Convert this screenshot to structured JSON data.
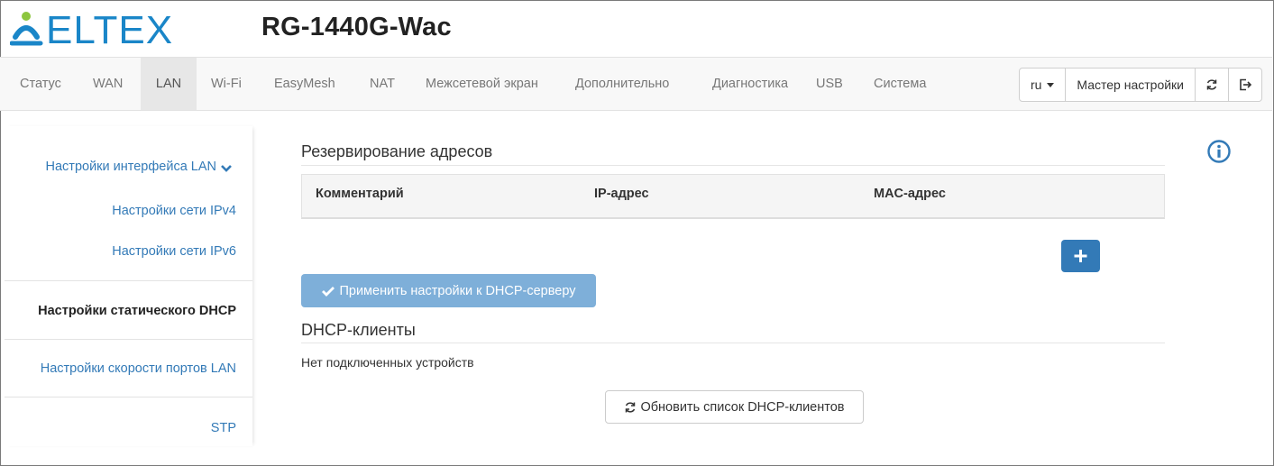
{
  "header": {
    "logo_text": "ELTEX",
    "device_name": "RG-1440G-Wac"
  },
  "nav": {
    "items": [
      {
        "label": "Статус",
        "active": false
      },
      {
        "label": "WAN",
        "active": false
      },
      {
        "label": "LAN",
        "active": true
      },
      {
        "label": "Wi-Fi",
        "active": false
      },
      {
        "label": "EasyMesh",
        "active": false
      },
      {
        "label": "NAT",
        "active": false
      },
      {
        "label": "Межсетевой экран",
        "active": false
      },
      {
        "label": "Дополнительно",
        "active": false
      },
      {
        "label": "Диагностика",
        "active": false
      },
      {
        "label": "USB",
        "active": false
      },
      {
        "label": "Система",
        "active": false
      }
    ],
    "language": "ru",
    "wizard_label": "Мастер настройки",
    "refresh_icon": "refresh-icon",
    "logout_icon": "logout-icon"
  },
  "sidebar": {
    "items": [
      {
        "label": "Настройки интерфейса LAN",
        "expandable": true
      },
      {
        "label": "Настройки сети IPv4"
      },
      {
        "label": "Настройки сети IPv6"
      },
      {
        "label": "Настройки статического DHCP",
        "active": true
      },
      {
        "label": "Настройки скорости портов LAN"
      },
      {
        "label": "STP"
      }
    ]
  },
  "main": {
    "reservation_title": "Резервирование адресов",
    "table_headers": [
      "Комментарий",
      "IP-адрес",
      "MAC-адрес"
    ],
    "add_button_icon": "plus-icon",
    "apply_button_label": "Применить настройки к DHCP-серверу",
    "clients_title": "DHCP-клиенты",
    "no_devices_text": "Нет подключенных устройств",
    "refresh_button_label": "Обновить список DHCP-клиентов"
  },
  "colors": {
    "brand_blue": "#337ab7",
    "logo_blue": "#1a86c8",
    "logo_green": "#8dc63f",
    "apply_disabled": "#7eafd9"
  }
}
